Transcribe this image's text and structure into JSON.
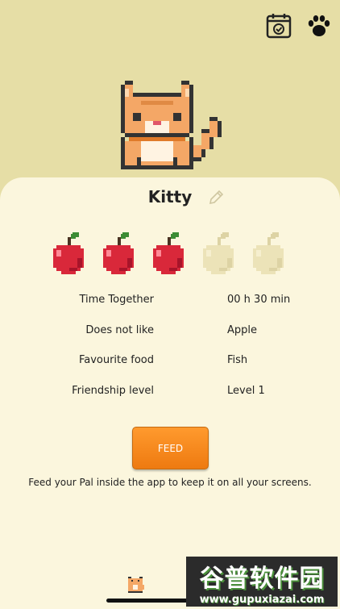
{
  "header": {
    "calendar_icon": "calendar-check-icon",
    "paw_icon": "paw-icon"
  },
  "pet": {
    "name": "Kitty",
    "edit_icon": "pencil-icon"
  },
  "friendship_apples": {
    "filled": 3,
    "total": 5
  },
  "stats": [
    {
      "label": "Time Together",
      "value": "00 h 30 min"
    },
    {
      "label": "Does not like",
      "value": "Apple"
    },
    {
      "label": "Favourite food",
      "value": "Fish"
    },
    {
      "label": "Friendship level",
      "value": "Level 1"
    }
  ],
  "feed": {
    "label": "FEED",
    "note": "Feed your Pal inside the app to keep it on all your screens."
  },
  "watermark": {
    "title": "谷普软件园",
    "url": "www.gupuxiazai.com"
  },
  "colors": {
    "background": "#e6dea6",
    "card": "#fbf6dd",
    "accent": "#f28a1c",
    "apple_red": "#d9283a",
    "apple_empty": "#ece3b8"
  }
}
